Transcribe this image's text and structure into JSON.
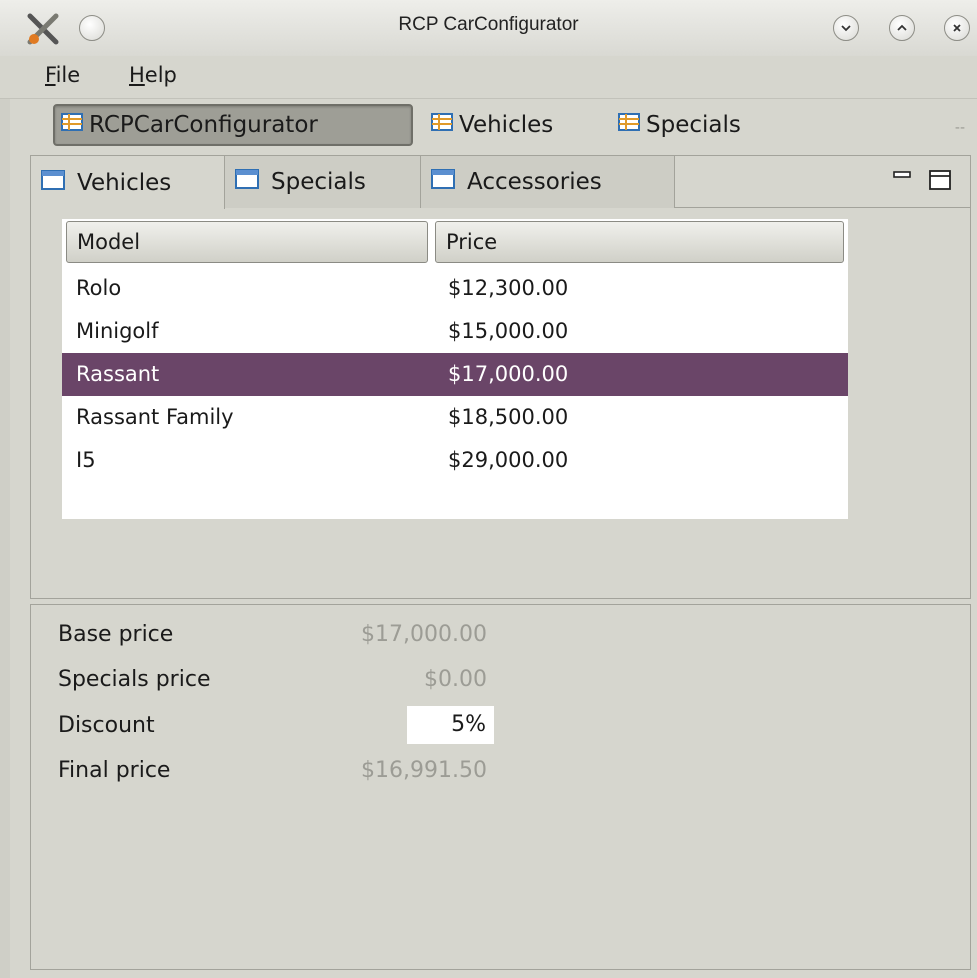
{
  "window": {
    "title": "RCP CarConfigurator",
    "buttons": [
      "minimize-icon",
      "maximize-icon",
      "close-icon"
    ]
  },
  "menu": {
    "items": [
      {
        "label": "File",
        "mnemonic": "F"
      },
      {
        "label": "Help",
        "mnemonic": "H"
      }
    ]
  },
  "perspectives": {
    "items": [
      {
        "label": "RCPCarConfigurator",
        "icon": "table-icon",
        "active": true
      },
      {
        "label": "Vehicles",
        "icon": "table-icon",
        "active": false
      },
      {
        "label": "Specials",
        "icon": "table-icon",
        "active": false
      }
    ],
    "more": "--"
  },
  "tabs": {
    "items": [
      {
        "label": "Vehicles",
        "icon": "view-icon",
        "active": true
      },
      {
        "label": "Specials",
        "icon": "view-icon",
        "active": false
      },
      {
        "label": "Accessories",
        "icon": "view-icon",
        "active": false
      }
    ],
    "controls": [
      "minimize-view-icon",
      "maximize-view-icon"
    ]
  },
  "table": {
    "columns": [
      "Model",
      "Price"
    ],
    "rows": [
      {
        "model": "Rolo",
        "price": "$12,300.00",
        "selected": false
      },
      {
        "model": "Minigolf",
        "price": "$15,000.00",
        "selected": false
      },
      {
        "model": "Rassant",
        "price": "$17,000.00",
        "selected": true
      },
      {
        "model": "Rassant Family",
        "price": "$18,500.00",
        "selected": false
      },
      {
        "model": "I5",
        "price": "$29,000.00",
        "selected": false
      }
    ]
  },
  "details": {
    "base_price_label": "Base price",
    "base_price_value": "$17,000.00",
    "specials_price_label": "Specials price",
    "specials_price_value": "$0.00",
    "discount_label": "Discount",
    "discount_value": "5%",
    "final_price_label": "Final price",
    "final_price_value": "$16,991.50"
  },
  "colors": {
    "selection": "#6a4568",
    "background": "#d6d6ce",
    "disabled_text": "#9c9c95"
  }
}
